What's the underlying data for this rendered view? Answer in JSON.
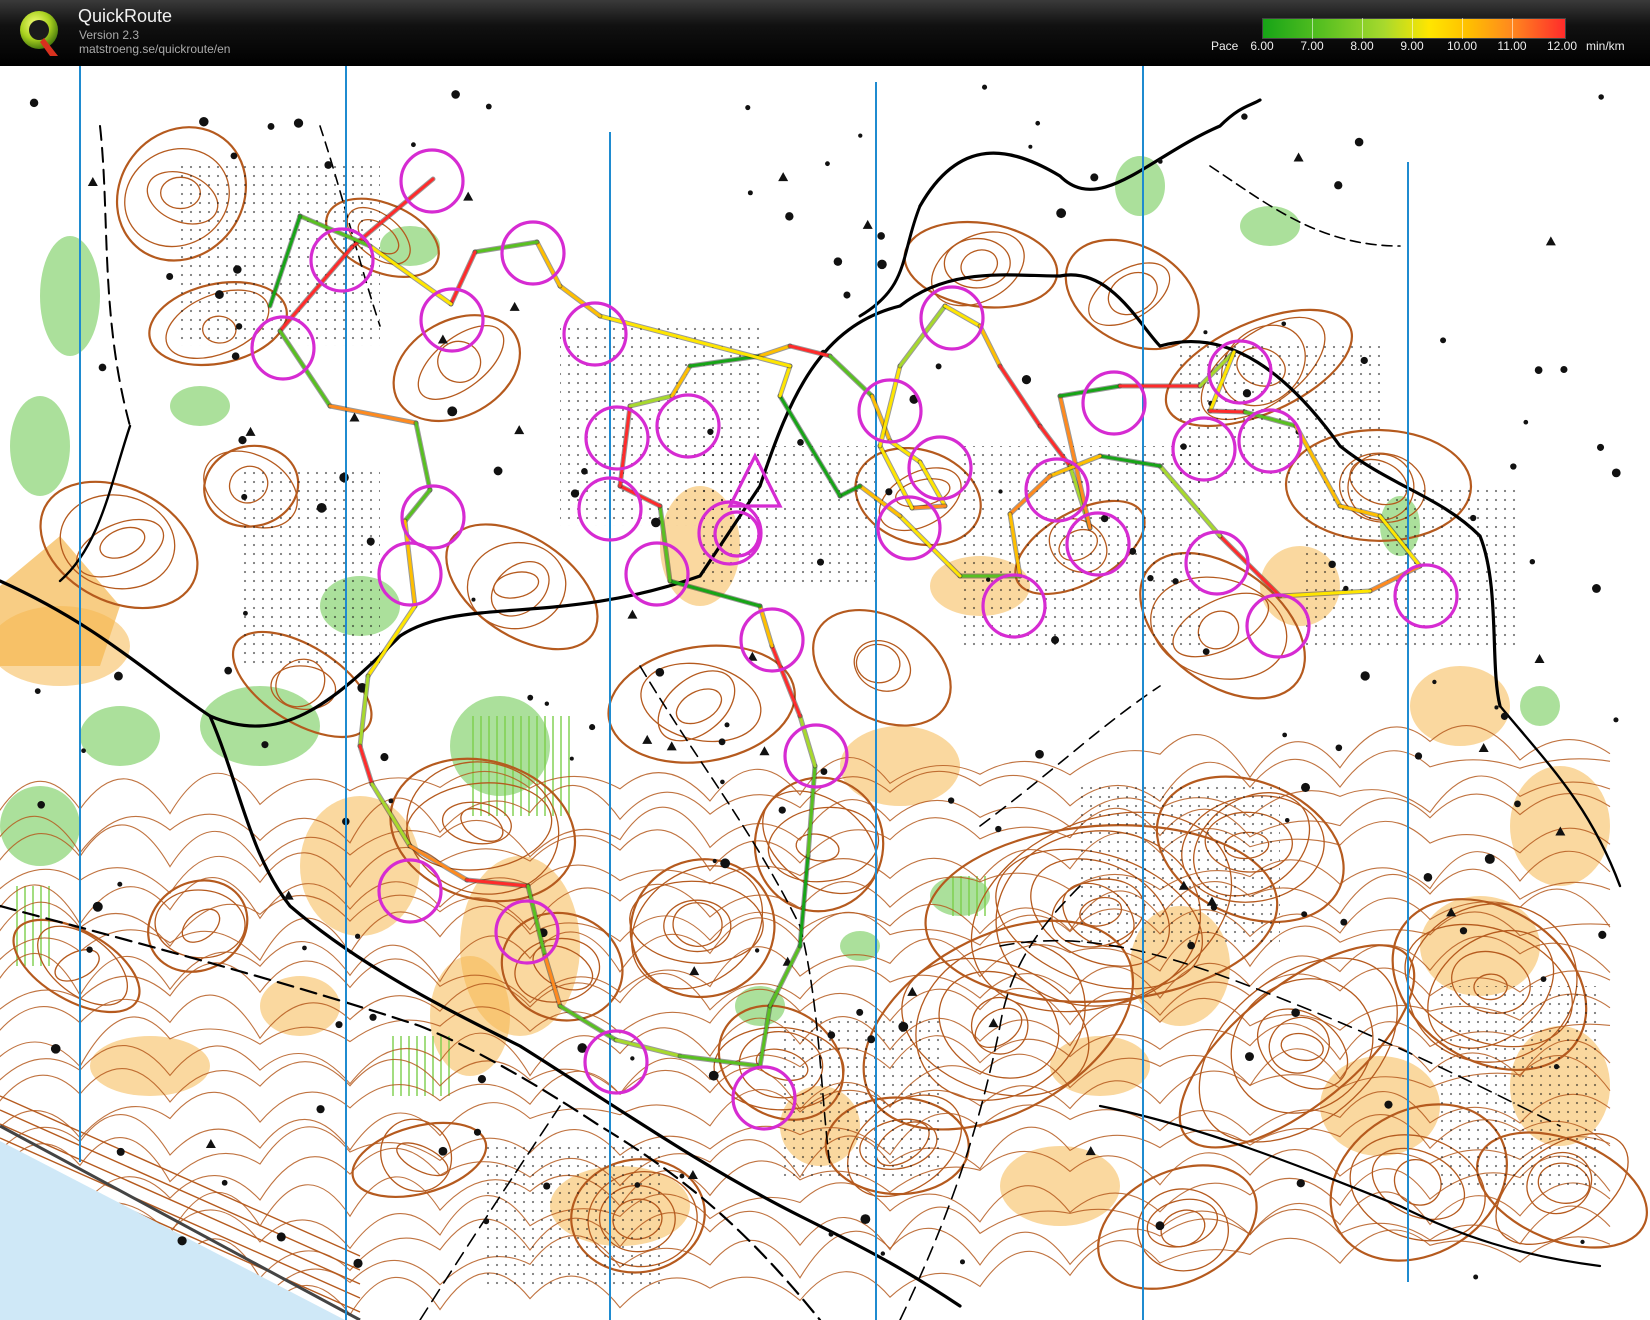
{
  "app": {
    "title": "QuickRoute",
    "version": "Version 2.3",
    "url": "matstroeng.se/quickroute/en",
    "logo_letter": "Q"
  },
  "pace_legend": {
    "label": "Pace",
    "values": [
      "6.00",
      "7.00",
      "8.00",
      "9.00",
      "10.00",
      "11.00",
      "12.00"
    ],
    "unit": "min/km",
    "colors": [
      "#17a417",
      "#59c021",
      "#a7d92d",
      "#ffe600",
      "#ffbf00",
      "#ff8a1e",
      "#ff2b2b"
    ]
  },
  "map": {
    "type": "orienteering map with GPS route",
    "colors": {
      "paper": "#ffffff",
      "open_land": "#f5b850",
      "contour": "#b55a1e",
      "vegetation": "#8fd67a",
      "track": "#000000",
      "magnetic_north_line": "#1f8bd0",
      "control_circle": "#d62bd2"
    }
  }
}
